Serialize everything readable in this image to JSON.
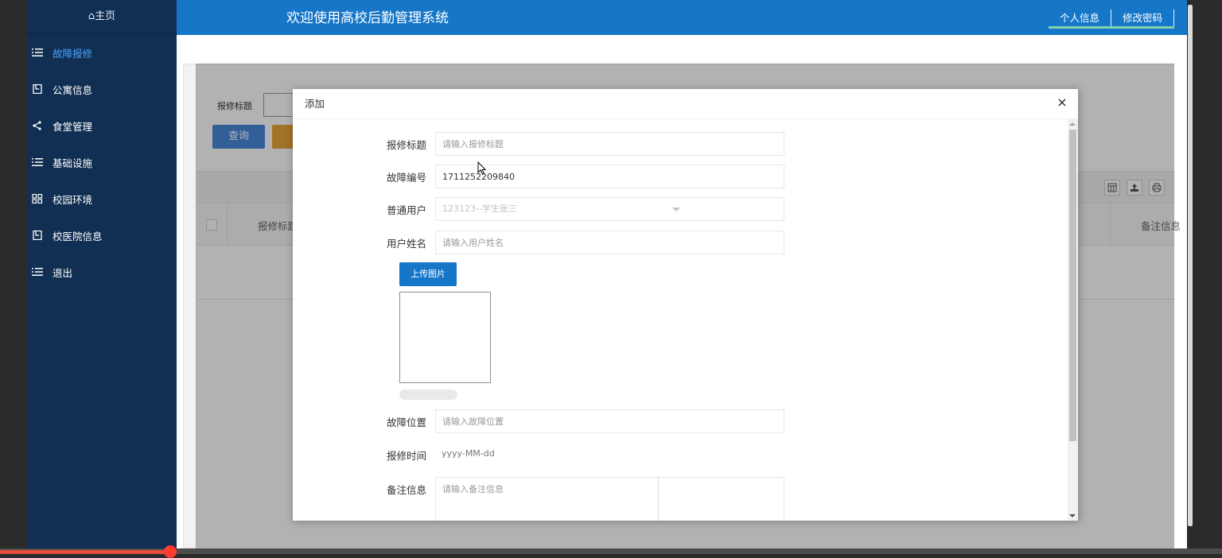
{
  "sidebar": {
    "home_label": "⌂主页",
    "items": [
      {
        "label": "故障报修",
        "icon": "list-icon",
        "active": true
      },
      {
        "label": "公寓信息",
        "icon": "book-icon",
        "active": false
      },
      {
        "label": "食堂管理",
        "icon": "share-icon",
        "active": false
      },
      {
        "label": "基础设施",
        "icon": "list-icon",
        "active": false
      },
      {
        "label": "校园环境",
        "icon": "grid-icon",
        "active": false
      },
      {
        "label": "校医院信息",
        "icon": "book-icon",
        "active": false
      },
      {
        "label": "退出",
        "icon": "list-icon",
        "active": false
      }
    ]
  },
  "header": {
    "title": "欢迎使用高校后勤管理系统",
    "links": [
      "个人信息",
      "修改密码"
    ]
  },
  "page": {
    "search_label": "报修标题",
    "query_button": "查询",
    "columns": [
      "报修标题",
      "备注信息"
    ]
  },
  "modal": {
    "title": "添加",
    "close_icon": "×",
    "fields": {
      "title_label": "报修标题",
      "title_placeholder": "请输入报修标题",
      "number_label": "故障编号",
      "number_value": "1711252209840",
      "user_label": "普通用户",
      "user_selected": "123123--学生张三",
      "name_label": "用户姓名",
      "name_placeholder": "请输入用户姓名",
      "upload_button": "上传图片",
      "location_label": "故障位置",
      "location_placeholder": "请输入故障位置",
      "time_label": "报修时间",
      "time_placeholder": "yyyy-MM-dd",
      "remark_label": "备注信息",
      "remark_placeholder": "请输入备注信息"
    }
  },
  "colors": {
    "sidebar_bg": "#102f52",
    "header_bg": "#1677c9",
    "active_menu": "#4aa3ff",
    "query_button": "#4a89dc",
    "upload_button": "#1677c9"
  }
}
